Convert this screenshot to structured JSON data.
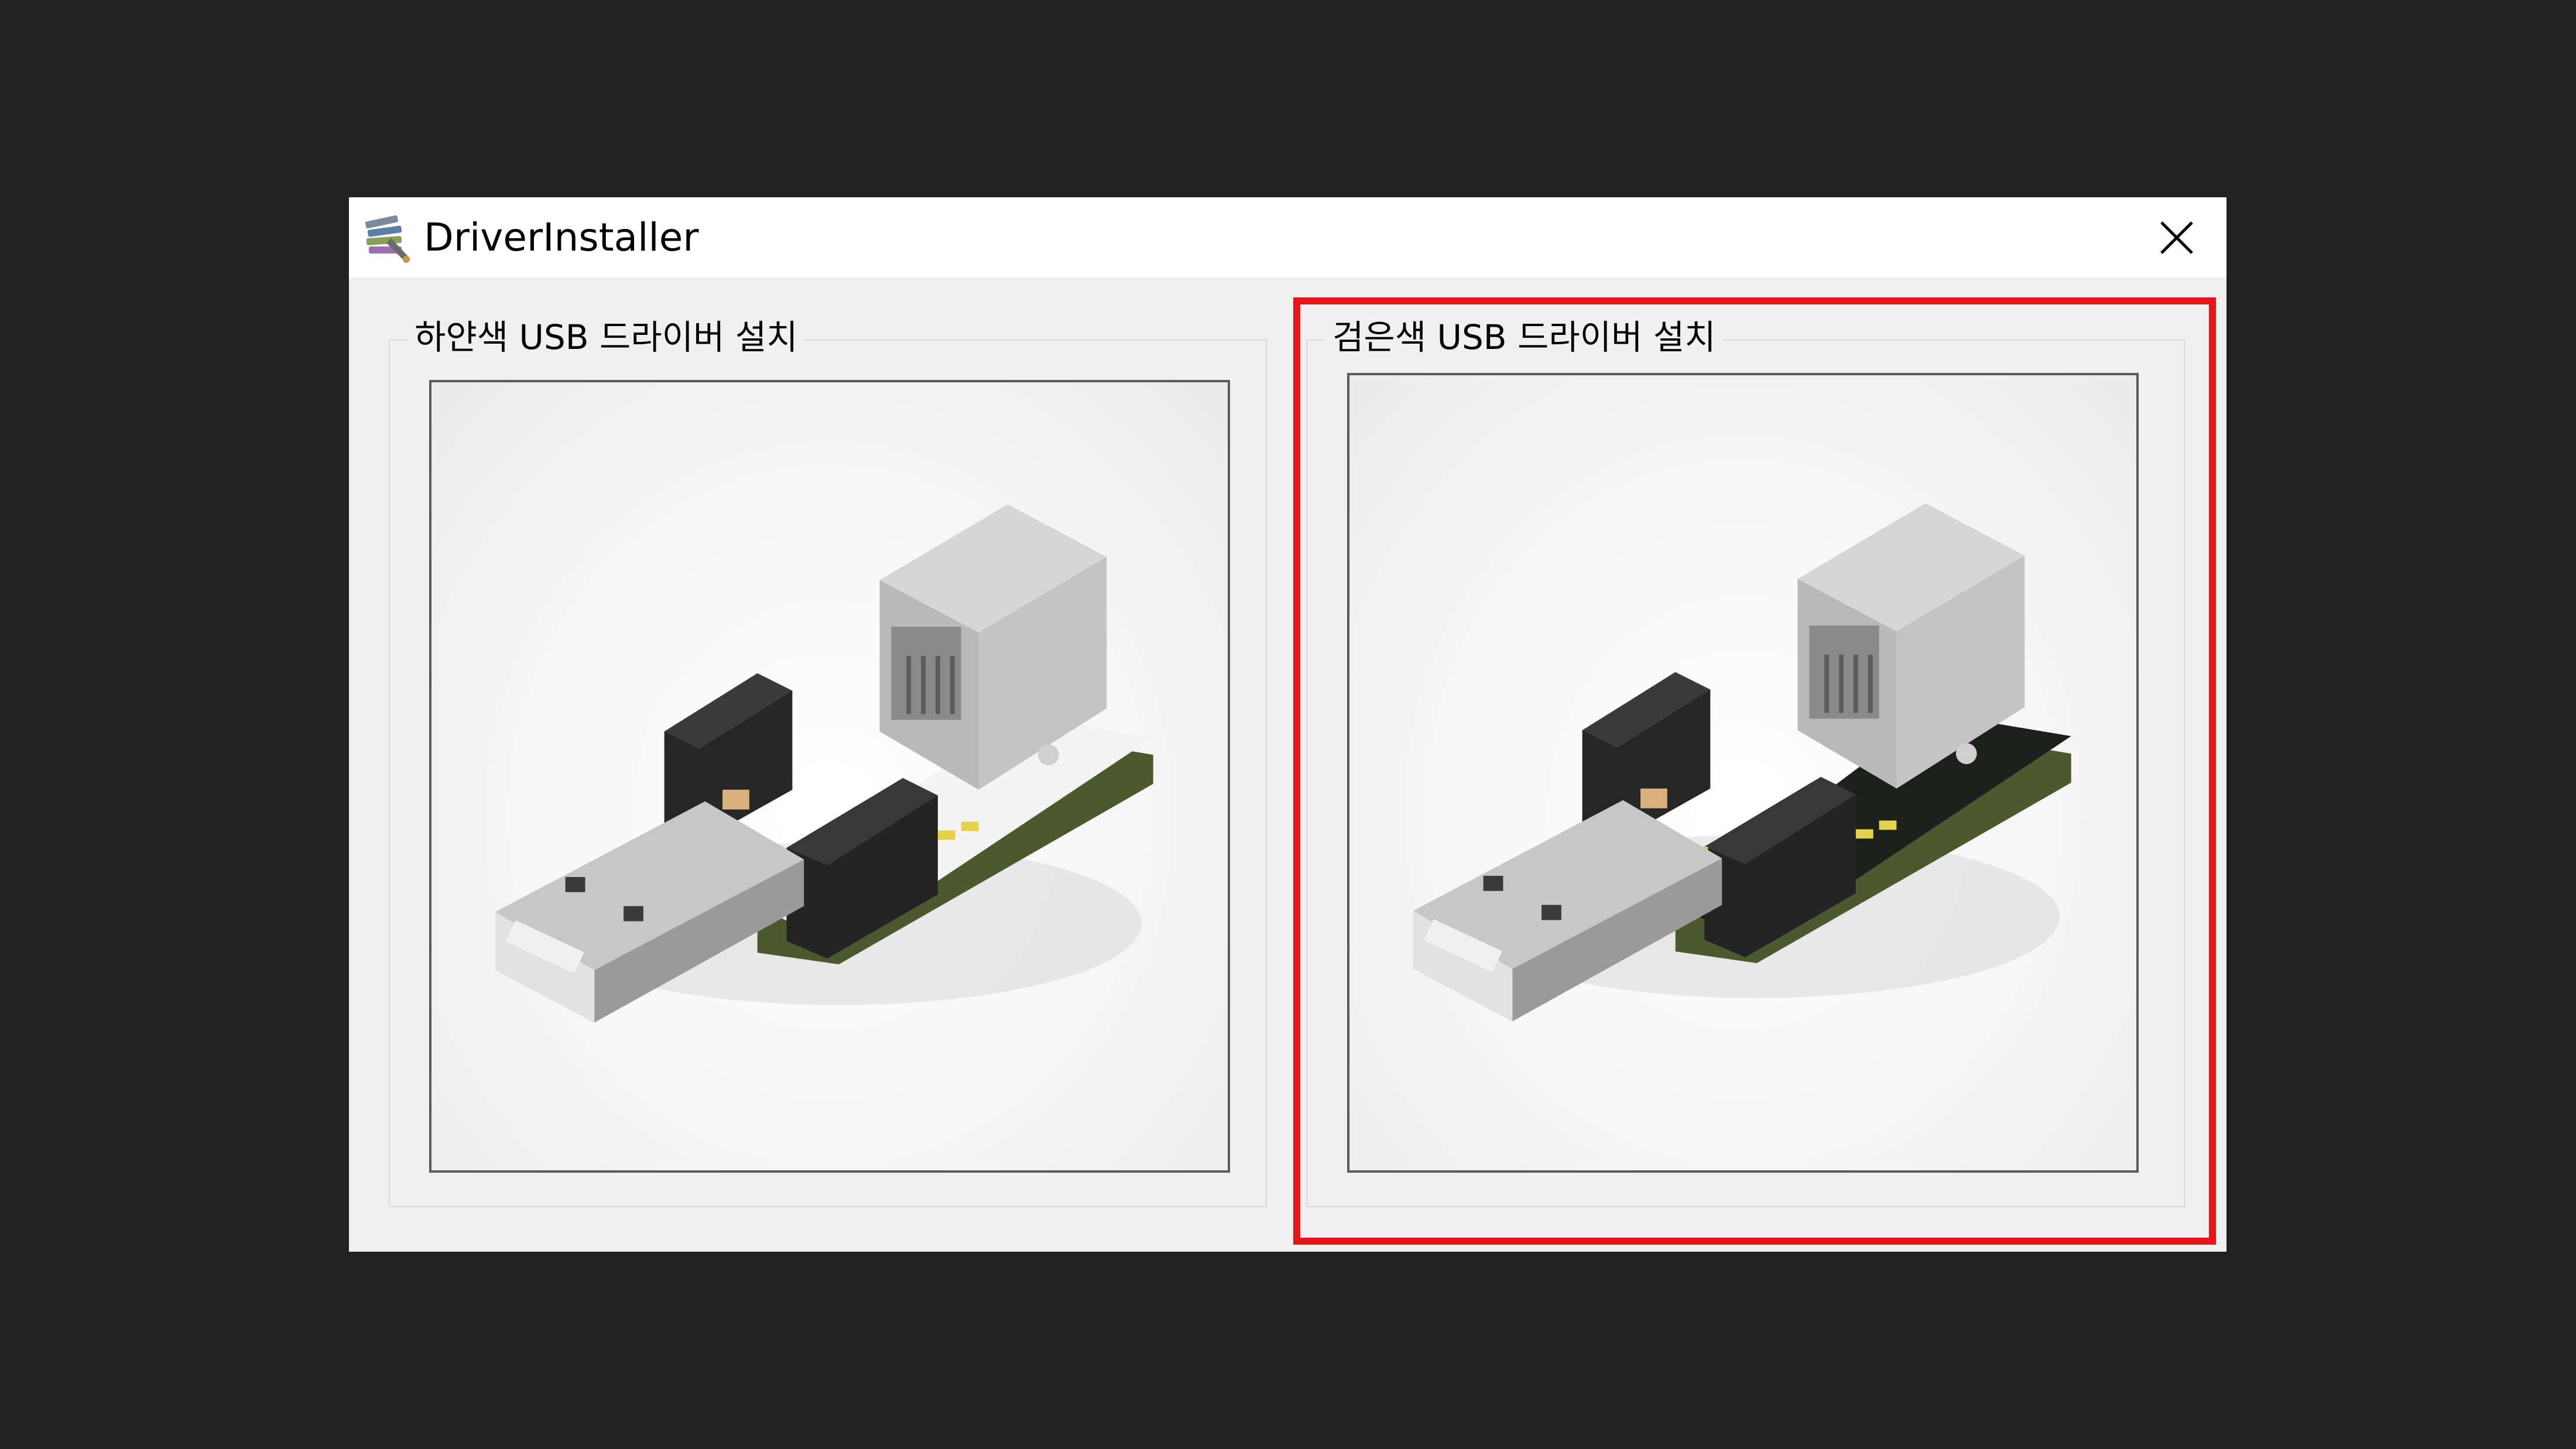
{
  "window": {
    "title": "DriverInstaller",
    "icon": "app-installer-icon",
    "close_icon": "close-icon"
  },
  "groups": [
    {
      "label": "하얀색 USB 드라이버 설치",
      "image": "usb-board-white-image",
      "board_color": "#f4f4f4"
    },
    {
      "label": "검은색 USB 드라이버 설치",
      "image": "usb-board-black-image",
      "board_color": "#1d1f1c"
    }
  ],
  "highlight": {
    "target": "black-usb-group",
    "color": "#e8141a"
  }
}
